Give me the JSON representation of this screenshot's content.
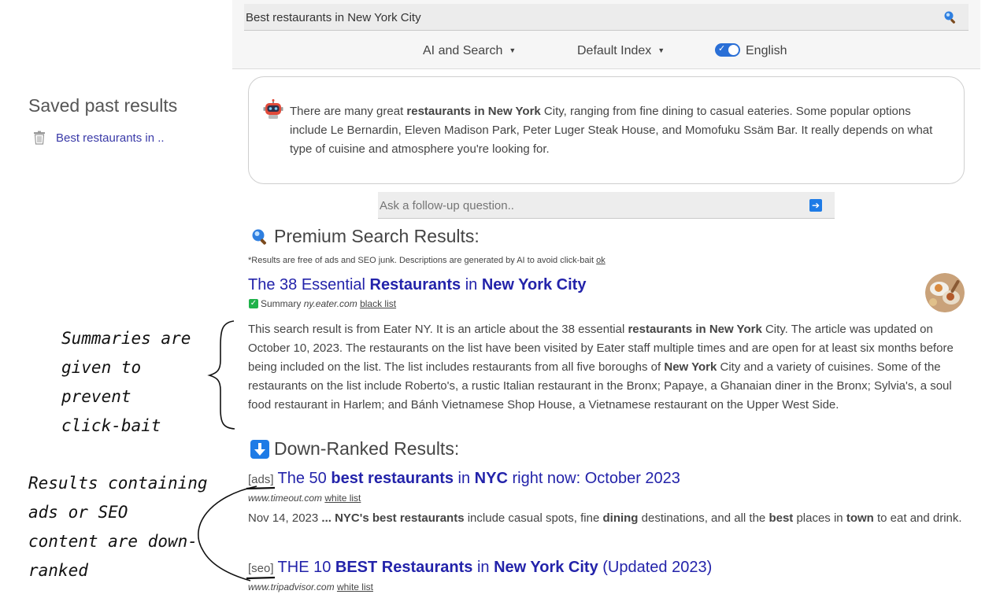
{
  "search": {
    "query": "Best restaurants in New York City",
    "icon": "magnifier-icon"
  },
  "options": {
    "mode_label": "AI and Search",
    "index_label": "Default Index",
    "language_label": "English",
    "language_enabled": true
  },
  "sidebar": {
    "title": "Saved past results",
    "items": [
      {
        "label": "Best restaurants in .."
      }
    ]
  },
  "ai_answer": {
    "parts": [
      {
        "text": "There are many great ",
        "bold": false
      },
      {
        "text": "restaurants in New York",
        "bold": true
      },
      {
        "text": " City, ranging from fine dining to casual eateries. Some popular options include Le Bernardin, Eleven Madison Park, Peter Luger Steak House, and Momofuku Ssäm Bar. It really depends on what type of cuisine and atmosphere you're looking for.",
        "bold": false
      }
    ]
  },
  "followup": {
    "placeholder": "Ask a follow-up question..",
    "send_icon": "arrow-right-icon"
  },
  "premium": {
    "title": "Premium Search Results:",
    "note": "*Results are free of ads and SEO junk. Descriptions are generated by AI to avoid click-bait",
    "note_link": "ok",
    "results": [
      {
        "title_parts": [
          {
            "text": "The 38 Essential ",
            "bold": false
          },
          {
            "text": "Restaurants",
            "bold": true
          },
          {
            "text": " in ",
            "bold": false
          },
          {
            "text": "New York City",
            "bold": true
          }
        ],
        "summary_label": "Summary",
        "domain": "ny.eater.com",
        "list_link": "black list",
        "body_parts": [
          {
            "text": "This search result is from Eater NY. It is an article about the 38 essential ",
            "bold": false
          },
          {
            "text": "restaurants in New York",
            "bold": true
          },
          {
            "text": " City. The article was updated on October 10, 2023. The restaurants on the list have been visited by Eater staff multiple times and are open for at least six months before being included on the list. The list includes restaurants from all five boroughs of ",
            "bold": false
          },
          {
            "text": "New York",
            "bold": true
          },
          {
            "text": " City and a variety of cuisines. Some of the restaurants on the list include Roberto's, a rustic Italian restaurant in the Bronx; Papaye, a Ghanaian diner in the Bronx; Sylvia's, a soul food restaurant in Harlem; and Bánh Vietnamese Shop House, a Vietnamese restaurant on the Upper West Side.",
            "bold": false
          }
        ]
      }
    ]
  },
  "downranked": {
    "title": "Down-Ranked Results:",
    "results": [
      {
        "tag": "[ads]",
        "title_parts": [
          {
            "text": "The 50 ",
            "bold": false
          },
          {
            "text": "best restaurants",
            "bold": true
          },
          {
            "text": " in ",
            "bold": false
          },
          {
            "text": "NYC",
            "bold": true
          },
          {
            "text": " right now: October 2023",
            "bold": false
          }
        ],
        "domain": "www.timeout.com",
        "list_link": "white list",
        "body_parts": [
          {
            "text": "Nov 14, 2023 ",
            "bold": false
          },
          {
            "text": "... NYC's best restaurants",
            "bold": true
          },
          {
            "text": " include casual spots, fine ",
            "bold": false
          },
          {
            "text": "dining",
            "bold": true
          },
          {
            "text": " destinations, and all the ",
            "bold": false
          },
          {
            "text": "best",
            "bold": true
          },
          {
            "text": " places in ",
            "bold": false
          },
          {
            "text": "town",
            "bold": true
          },
          {
            "text": " to eat and drink.",
            "bold": false
          }
        ]
      },
      {
        "tag": "[seo]",
        "title_parts": [
          {
            "text": "THE 10 ",
            "bold": false
          },
          {
            "text": "BEST Restaurants",
            "bold": true
          },
          {
            "text": " in ",
            "bold": false
          },
          {
            "text": "New York City",
            "bold": true
          },
          {
            "text": " (Updated 2023)",
            "bold": false
          }
        ],
        "domain": "www.tripadvisor.com",
        "list_link": "white list"
      }
    ]
  },
  "annotations": {
    "note1_lines": [
      "Summaries are",
      "given to prevent",
      "click-bait"
    ],
    "note2_lines": [
      "Results containing",
      "ads or SEO",
      "content are down-",
      "ranked"
    ]
  }
}
